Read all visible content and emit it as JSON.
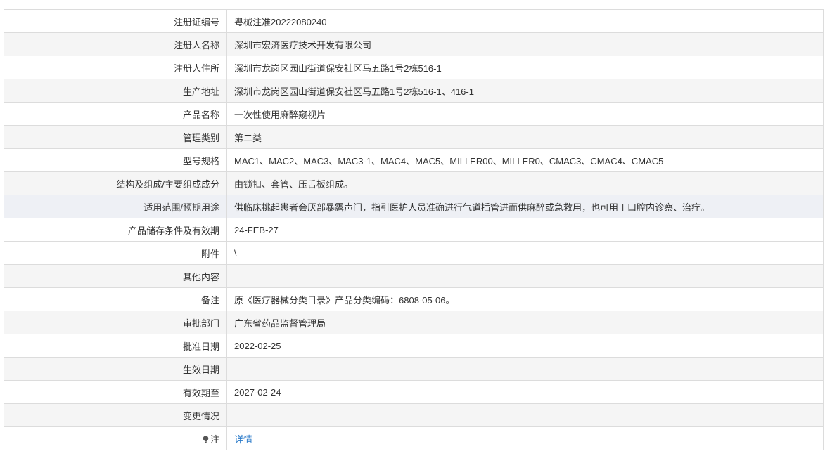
{
  "rows": [
    {
      "label": "注册证编号",
      "value": "粤械注准20222080240"
    },
    {
      "label": "注册人名称",
      "value": "深圳市宏济医疗技术开发有限公司"
    },
    {
      "label": "注册人住所",
      "value": "深圳市龙岗区园山街道保安社区马五路1号2栋516-1"
    },
    {
      "label": "生产地址",
      "value": "深圳市龙岗区园山街道保安社区马五路1号2栋516-1、416-1"
    },
    {
      "label": "产品名称",
      "value": "一次性使用麻醉窥视片"
    },
    {
      "label": "管理类别",
      "value": "第二类"
    },
    {
      "label": "型号规格",
      "value": "MAC1、MAC2、MAC3、MAC3-1、MAC4、MAC5、MILLER00、MILLER0、CMAC3、CMAC4、CMAC5"
    },
    {
      "label": "结构及组成/主要组成成分",
      "value": "由锁扣、套管、压舌板组成。"
    },
    {
      "label": "适用范围/预期用途",
      "value": "供临床挑起患者会厌部暴露声门，指引医护人员准确进行气道插管进而供麻醉或急救用，也可用于口腔内诊察、治疗。"
    },
    {
      "label": "产品储存条件及有效期",
      "value": "24-FEB-27"
    },
    {
      "label": "附件",
      "value": "\\"
    },
    {
      "label": "其他内容",
      "value": ""
    },
    {
      "label": "备注",
      "value": "原《医疗器械分类目录》产品分类编码：6808-05-06。"
    },
    {
      "label": "审批部门",
      "value": "广东省药品监督管理局"
    },
    {
      "label": "批准日期",
      "value": "2022-02-25"
    },
    {
      "label": "生效日期",
      "value": ""
    },
    {
      "label": "有效期至",
      "value": "2027-02-24"
    },
    {
      "label": "变更情况",
      "value": ""
    }
  ],
  "note": {
    "icon": "lightbulb-icon",
    "label": "注",
    "link_text": "详情"
  },
  "colors": {
    "border": "#dcdcdc",
    "row_alt": "#f5f5f5",
    "row_highlight": "#eef0f5",
    "link": "#2a7ac9",
    "text": "#333333"
  }
}
